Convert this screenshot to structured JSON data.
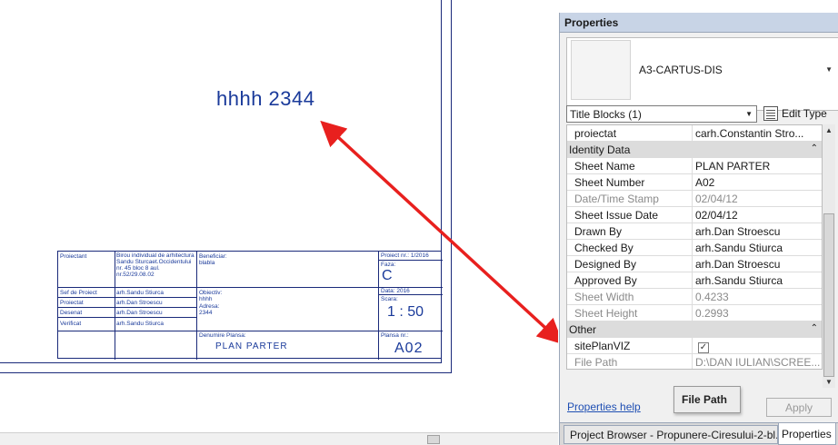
{
  "canvas": {
    "sheet_text": "hhhh 2344",
    "title_block": {
      "proiectant_label": "Proiectant",
      "proiectant_value": "Birou individual de arhitectura Sandu Sturcaet.Occidentului nr. 45 bloc 8 aul. nr.52/29.08.02",
      "beneficiar_label": "Beneficiar:",
      "beneficiar_value": "blabla",
      "proiect_nr": "Proiect nr.: 1/2016",
      "faza_label": "Faza:",
      "faza_value": "C",
      "sef_proiect_label": "Sef de Proiect",
      "sef_proiect_value": "arh.Sandu Stiurca",
      "proiectat_label": "Proiectat",
      "proiectat_value": "arh.Dan Stroescu",
      "desenat_label": "Desenat",
      "desenat_value": "arh.Dan Stroescu",
      "verificat_label": "Verificat",
      "verificat_value": "arh.Sandu Stiurca",
      "obiectiv_label": "Obiectiv:",
      "obiectiv_value": "hhhh",
      "adresa_label": "Adresa:",
      "adresa_value": "2344",
      "data_label": "Data: 2016",
      "scara_label": "Scara:",
      "scara_value": "1 : 50",
      "denumire_label": "Denumire Plansa:",
      "denumire_value": "PLAN PARTER",
      "plansa_label": "Plansa nr.:",
      "plansa_value": "A02"
    }
  },
  "properties": {
    "title": "Properties",
    "type_name": "A3-CARTUS-DIS",
    "category_filter": "Title Blocks (1)",
    "edit_type_label": "Edit Type",
    "rows": [
      {
        "kind": "param",
        "key": "proiectat",
        "value": "carh.Constantin Stro...",
        "readonly": false
      },
      {
        "kind": "group",
        "key": "Identity Data"
      },
      {
        "kind": "param",
        "key": "Sheet Name",
        "value": "PLAN PARTER",
        "readonly": false
      },
      {
        "kind": "param",
        "key": "Sheet Number",
        "value": "A02",
        "readonly": false
      },
      {
        "kind": "param",
        "key": "Date/Time Stamp",
        "value": "02/04/12",
        "readonly": true
      },
      {
        "kind": "param",
        "key": "Sheet Issue Date",
        "value": "02/04/12",
        "readonly": false
      },
      {
        "kind": "param",
        "key": "Drawn By",
        "value": "arh.Dan Stroescu",
        "readonly": false
      },
      {
        "kind": "param",
        "key": "Checked By",
        "value": "arh.Sandu Stiurca",
        "readonly": false
      },
      {
        "kind": "param",
        "key": "Designed By",
        "value": "arh.Dan Stroescu",
        "readonly": false
      },
      {
        "kind": "param",
        "key": "Approved By",
        "value": "arh.Sandu Stiurca",
        "readonly": false
      },
      {
        "kind": "param",
        "key": "Sheet Width",
        "value": "0.4233",
        "readonly": true
      },
      {
        "kind": "param",
        "key": "Sheet Height",
        "value": "0.2993",
        "readonly": true
      },
      {
        "kind": "group",
        "key": "Other"
      },
      {
        "kind": "check",
        "key": "sitePlanVIZ",
        "value": "✓",
        "readonly": false
      },
      {
        "kind": "param",
        "key": "File Path",
        "value": "D:\\DAN IULIAN\\SCREE...",
        "readonly": true
      }
    ],
    "collapse_glyph": "⌃",
    "help_link": "Properties help",
    "apply_label": "Apply",
    "tooltip": "File Path",
    "tabs": {
      "project_browser": "Project Browser - Propunere-Ciresului-2-bl...",
      "properties": "Properties"
    }
  },
  "colors": {
    "arrow": "#e8201e",
    "drawing_line": "#1a2a7a",
    "drawing_text": "#1a3a9a"
  }
}
